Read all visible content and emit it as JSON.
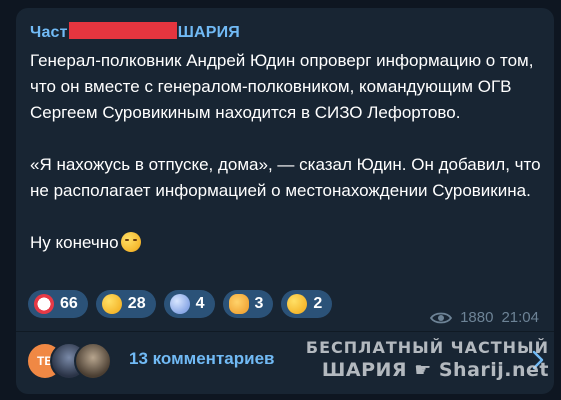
{
  "channel": {
    "name_start": "Част",
    "name_end": "ШАРИЯ"
  },
  "post": {
    "paragraph1": "Генерал-полковник Андрей Юдин опроверг информацию о том, что он вместе с генералом-полковником, командующим ОГВ Сергеем Суровикиным находится в СИЗО Лефортово.",
    "paragraph2": "«Я нахожусь в отпуске, дома», — сказал Юдин. Он добавил, что не располагает информацией о местонахождении Суровикина.",
    "paragraph3": "Ну конечно",
    "trailing_emoji": "smirk-emoji"
  },
  "reactions": [
    {
      "emoji": "clown-emoji",
      "count": "66"
    },
    {
      "emoji": "grin-emoji",
      "count": "28"
    },
    {
      "emoji": "scream-emoji",
      "count": "4"
    },
    {
      "emoji": "thumbs-up-emoji",
      "count": "3"
    },
    {
      "emoji": "woozy-emoji",
      "count": "2"
    }
  ],
  "meta": {
    "views": "1880",
    "time": "21:04"
  },
  "comments": {
    "avatar1_initials": "ТВ",
    "label": "13 комментариев"
  },
  "watermark": {
    "line1": "БЕСПЛАТНЫЙ ЧАСТНЫЙ",
    "line2_word": "ШАРИЯ",
    "line2_site": "Sharij.net"
  },
  "colors": {
    "background": "#0e1621",
    "bubble": "#182533",
    "accent": "#71baf5",
    "reaction_bg": "#2b5278",
    "redaction": "#e5353f"
  }
}
